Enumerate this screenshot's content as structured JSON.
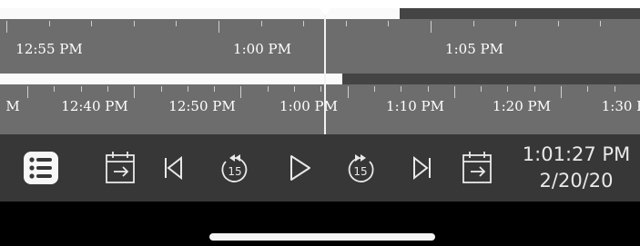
{
  "timeline_top": {
    "labels": [
      "12:55 PM",
      "1:00 PM",
      "1:05 PM"
    ],
    "played_fraction": 0.625
  },
  "timeline_bottom": {
    "labels": [
      "M",
      "12:40 PM",
      "12:50 PM",
      "1:00 PM",
      "1:10 PM",
      "1:20 PM",
      "1:30 P"
    ],
    "played_fraction": 0.535
  },
  "controls": {
    "skip_back_seconds": "15",
    "skip_forward_seconds": "15"
  },
  "timestamp": {
    "time": "1:01:27 PM",
    "date": "2/20/20"
  },
  "colors": {
    "timeline_bg": "#6d6d6d",
    "played": "#fafafa",
    "buffer": "#444444",
    "controls_bg": "#373737"
  },
  "icons": [
    "list-icon",
    "calendar-back-icon",
    "skip-to-start-icon",
    "rewind-15-icon",
    "play-icon",
    "forward-15-icon",
    "skip-to-end-icon",
    "calendar-forward-icon"
  ]
}
